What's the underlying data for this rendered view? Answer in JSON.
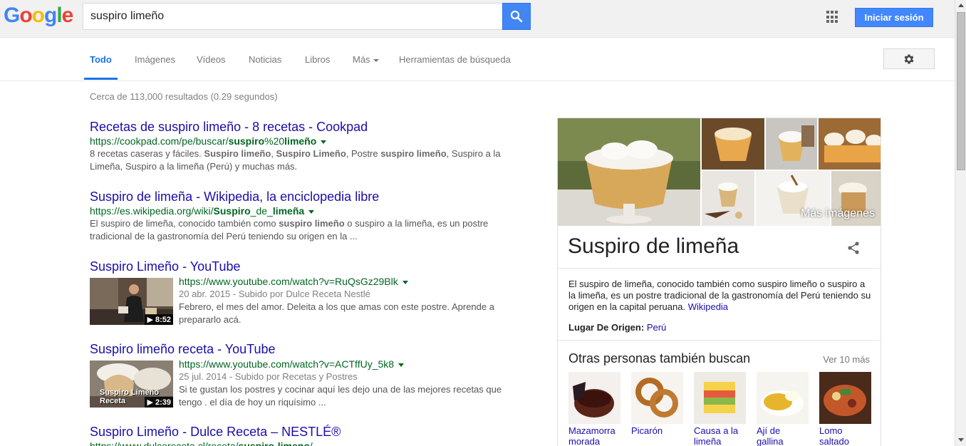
{
  "header": {
    "logo_letters": [
      {
        "ch": "G",
        "color": "#4285f4"
      },
      {
        "ch": "o",
        "color": "#ea4335"
      },
      {
        "ch": "o",
        "color": "#fbbc05"
      },
      {
        "ch": "g",
        "color": "#4285f4"
      },
      {
        "ch": "l",
        "color": "#34a853"
      },
      {
        "ch": "e",
        "color": "#ea4335"
      }
    ],
    "search_value": "suspiro limeño",
    "search_icon": "search-icon",
    "apps_icon": "apps-grid-icon",
    "signin_label": "Iniciar sesión"
  },
  "tabs": {
    "items": [
      "Todo",
      "Imágenes",
      "Vídeos",
      "Noticias",
      "Libros",
      "Más",
      "Herramientas de búsqueda"
    ],
    "active": "Todo",
    "settings_icon": "gear-icon"
  },
  "results": {
    "stats": "Cerca de 113,000 resultados (0.29 segundos)",
    "items": [
      {
        "title": "Recetas de suspiro limeño - 8 recetas - Cookpad",
        "url_plain": "https://cookpad.com/pe/buscar/",
        "url_bold": "suspiro",
        "url_mid": "%20",
        "url_bold2": "limeño",
        "snippet_html": "8 recetas caseras y fáciles. <b>Suspiro limeño</b>, <b>Suspiro Limeño</b>, Postre <b>suspiro limeño</b>, Suspiro a la Limeña, Suspiro a la limeña (Perú) y muchas más."
      },
      {
        "title": "Suspiro de limeña - Wikipedia, la enciclopedia libre",
        "url_plain": "https://es.wikipedia.org/wiki/",
        "url_bold": "Suspiro",
        "url_mid": "_de_",
        "url_bold2": "limeña",
        "snippet_html": "El suspiro de limeña, conocido también como <b>suspiro limeño</b> o suspiro a la limeña, es un postre tradicional de la gastronomía del Perú teniendo su origen en la ..."
      },
      {
        "title": "Suspiro Limeño - YouTube",
        "url": "https://www.youtube.com/watch?v=RuQsGz29Blk",
        "date": "20 abr. 2015 - Subido por Dulce Receta Nestlé",
        "snippet": "Febrero, el mes del amor. Deleita a los que amas con este postre. Aprende a prepararlo acá.",
        "duration": "▶ 8:52"
      },
      {
        "title": "Suspiro limeño receta - YouTube",
        "url": "https://www.youtube.com/watch?v=ACTffUy_5k8",
        "date": "25 jul. 2014 - Subido por Recetas y Postres",
        "snippet": "Si te gustan los postres y cocinar aquí les dejo una de las mejores recetas que tengo . el día de hoy un riquísimo ...",
        "duration": "▶ 2:39",
        "thumb_text": "Suspiro Limeño Receta"
      },
      {
        "title": "Suspiro Limeño - Dulce Receta – NESTLÉ®",
        "url_plain": "https://www.dulcereceta.cl/receta/",
        "url_bold": "suspiro-limeno",
        "url_mid": "/",
        "url_bold2": ""
      }
    ]
  },
  "knowledge_panel": {
    "more_images": "Más imágenes",
    "title": "Suspiro de limeña",
    "share_icon": "share-icon",
    "description": "El suspiro de limeña, conocido también como suspiro limeño o suspiro a la limeña, es un postre tradicional de la gastronomía del Perú teniendo su origen en la capital peruana.",
    "source": "Wikipedia",
    "origin_label": "Lugar De Origen:",
    "origin_value": "Perú",
    "also_title": "Otras personas también buscan",
    "also_more": "Ver 10 más",
    "also_items": [
      "Mazamorra morada",
      "Picarón",
      "Causa a la limeña",
      "Ají de gallina",
      "Lomo saltado"
    ]
  },
  "colors": {
    "link": "#1a0dab",
    "url_green": "#006621",
    "accent_blue": "#4285f4",
    "active_tab": "#1a73e8"
  }
}
